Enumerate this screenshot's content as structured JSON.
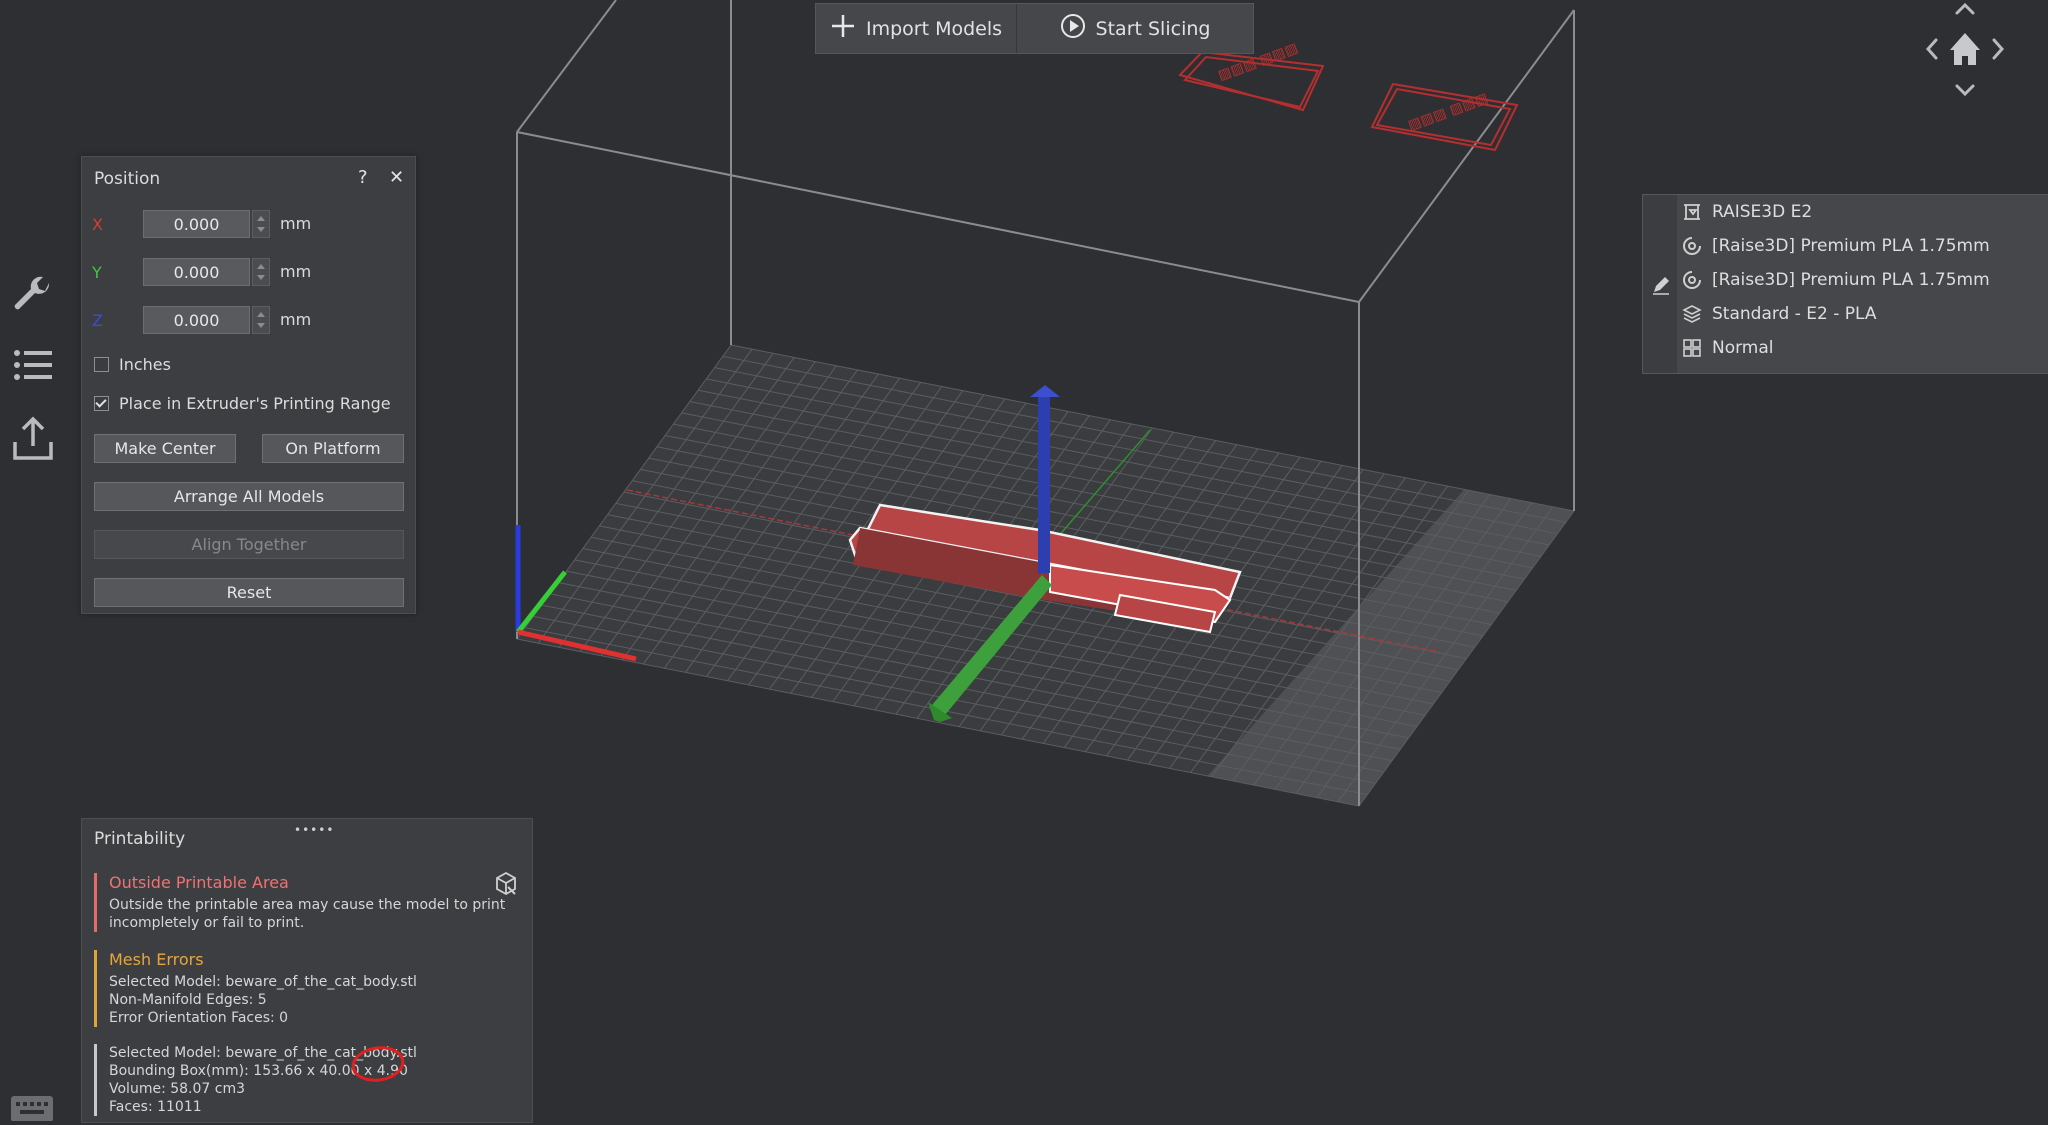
{
  "toolbar": {
    "import_label": "Import Models",
    "slice_label": "Start Slicing"
  },
  "position_panel": {
    "title": "Position",
    "help": "?",
    "close": "✕",
    "axes": [
      {
        "label": "X",
        "value": "0.000",
        "unit": "mm",
        "color": "#d83a3a"
      },
      {
        "label": "Y",
        "value": "0.000",
        "unit": "mm",
        "color": "#3ec83e"
      },
      {
        "label": "Z",
        "value": "0.000",
        "unit": "mm",
        "color": "#3a4bd8"
      }
    ],
    "inches_label": "Inches",
    "inches_checked": false,
    "place_label": "Place in Extruder's Printing Range",
    "place_checked": true,
    "make_center": "Make Center",
    "on_platform": "On Platform",
    "arrange_all": "Arrange All Models",
    "align_together": "Align Together",
    "reset": "Reset"
  },
  "printability": {
    "title": "Printability",
    "drag": "•••••",
    "outside_title": "Outside Printable Area",
    "outside_line1": "Outside the printable area may cause the model to print",
    "outside_line2": "incompletely or fail to print.",
    "mesh_title": "Mesh Errors",
    "mesh_model": "Selected Model: beware_of_the_cat_body.stl",
    "mesh_edges": "Non-Manifold Edges: 5",
    "mesh_faces": "Error Orientation Faces: 0",
    "info_model": "Selected Model: beware_of_the_cat_body.stl",
    "info_bbox": "Bounding Box(mm): 153.66 x 40.00 x 4.90",
    "info_volume": "Volume: 58.07 cm3",
    "info_faces": "Faces: 11011"
  },
  "info_panel": {
    "printer": "RAISE3D E2",
    "filament_left": "[Raise3D] Premium PLA 1.75mm",
    "filament_right": "[Raise3D] Premium PLA 1.75mm",
    "profile": "Standard - E2 - PLA",
    "mode": "Normal"
  },
  "colors": {
    "accent_red": "#f07373",
    "accent_yellow": "#e7a63c",
    "model_red": "#b84545"
  }
}
